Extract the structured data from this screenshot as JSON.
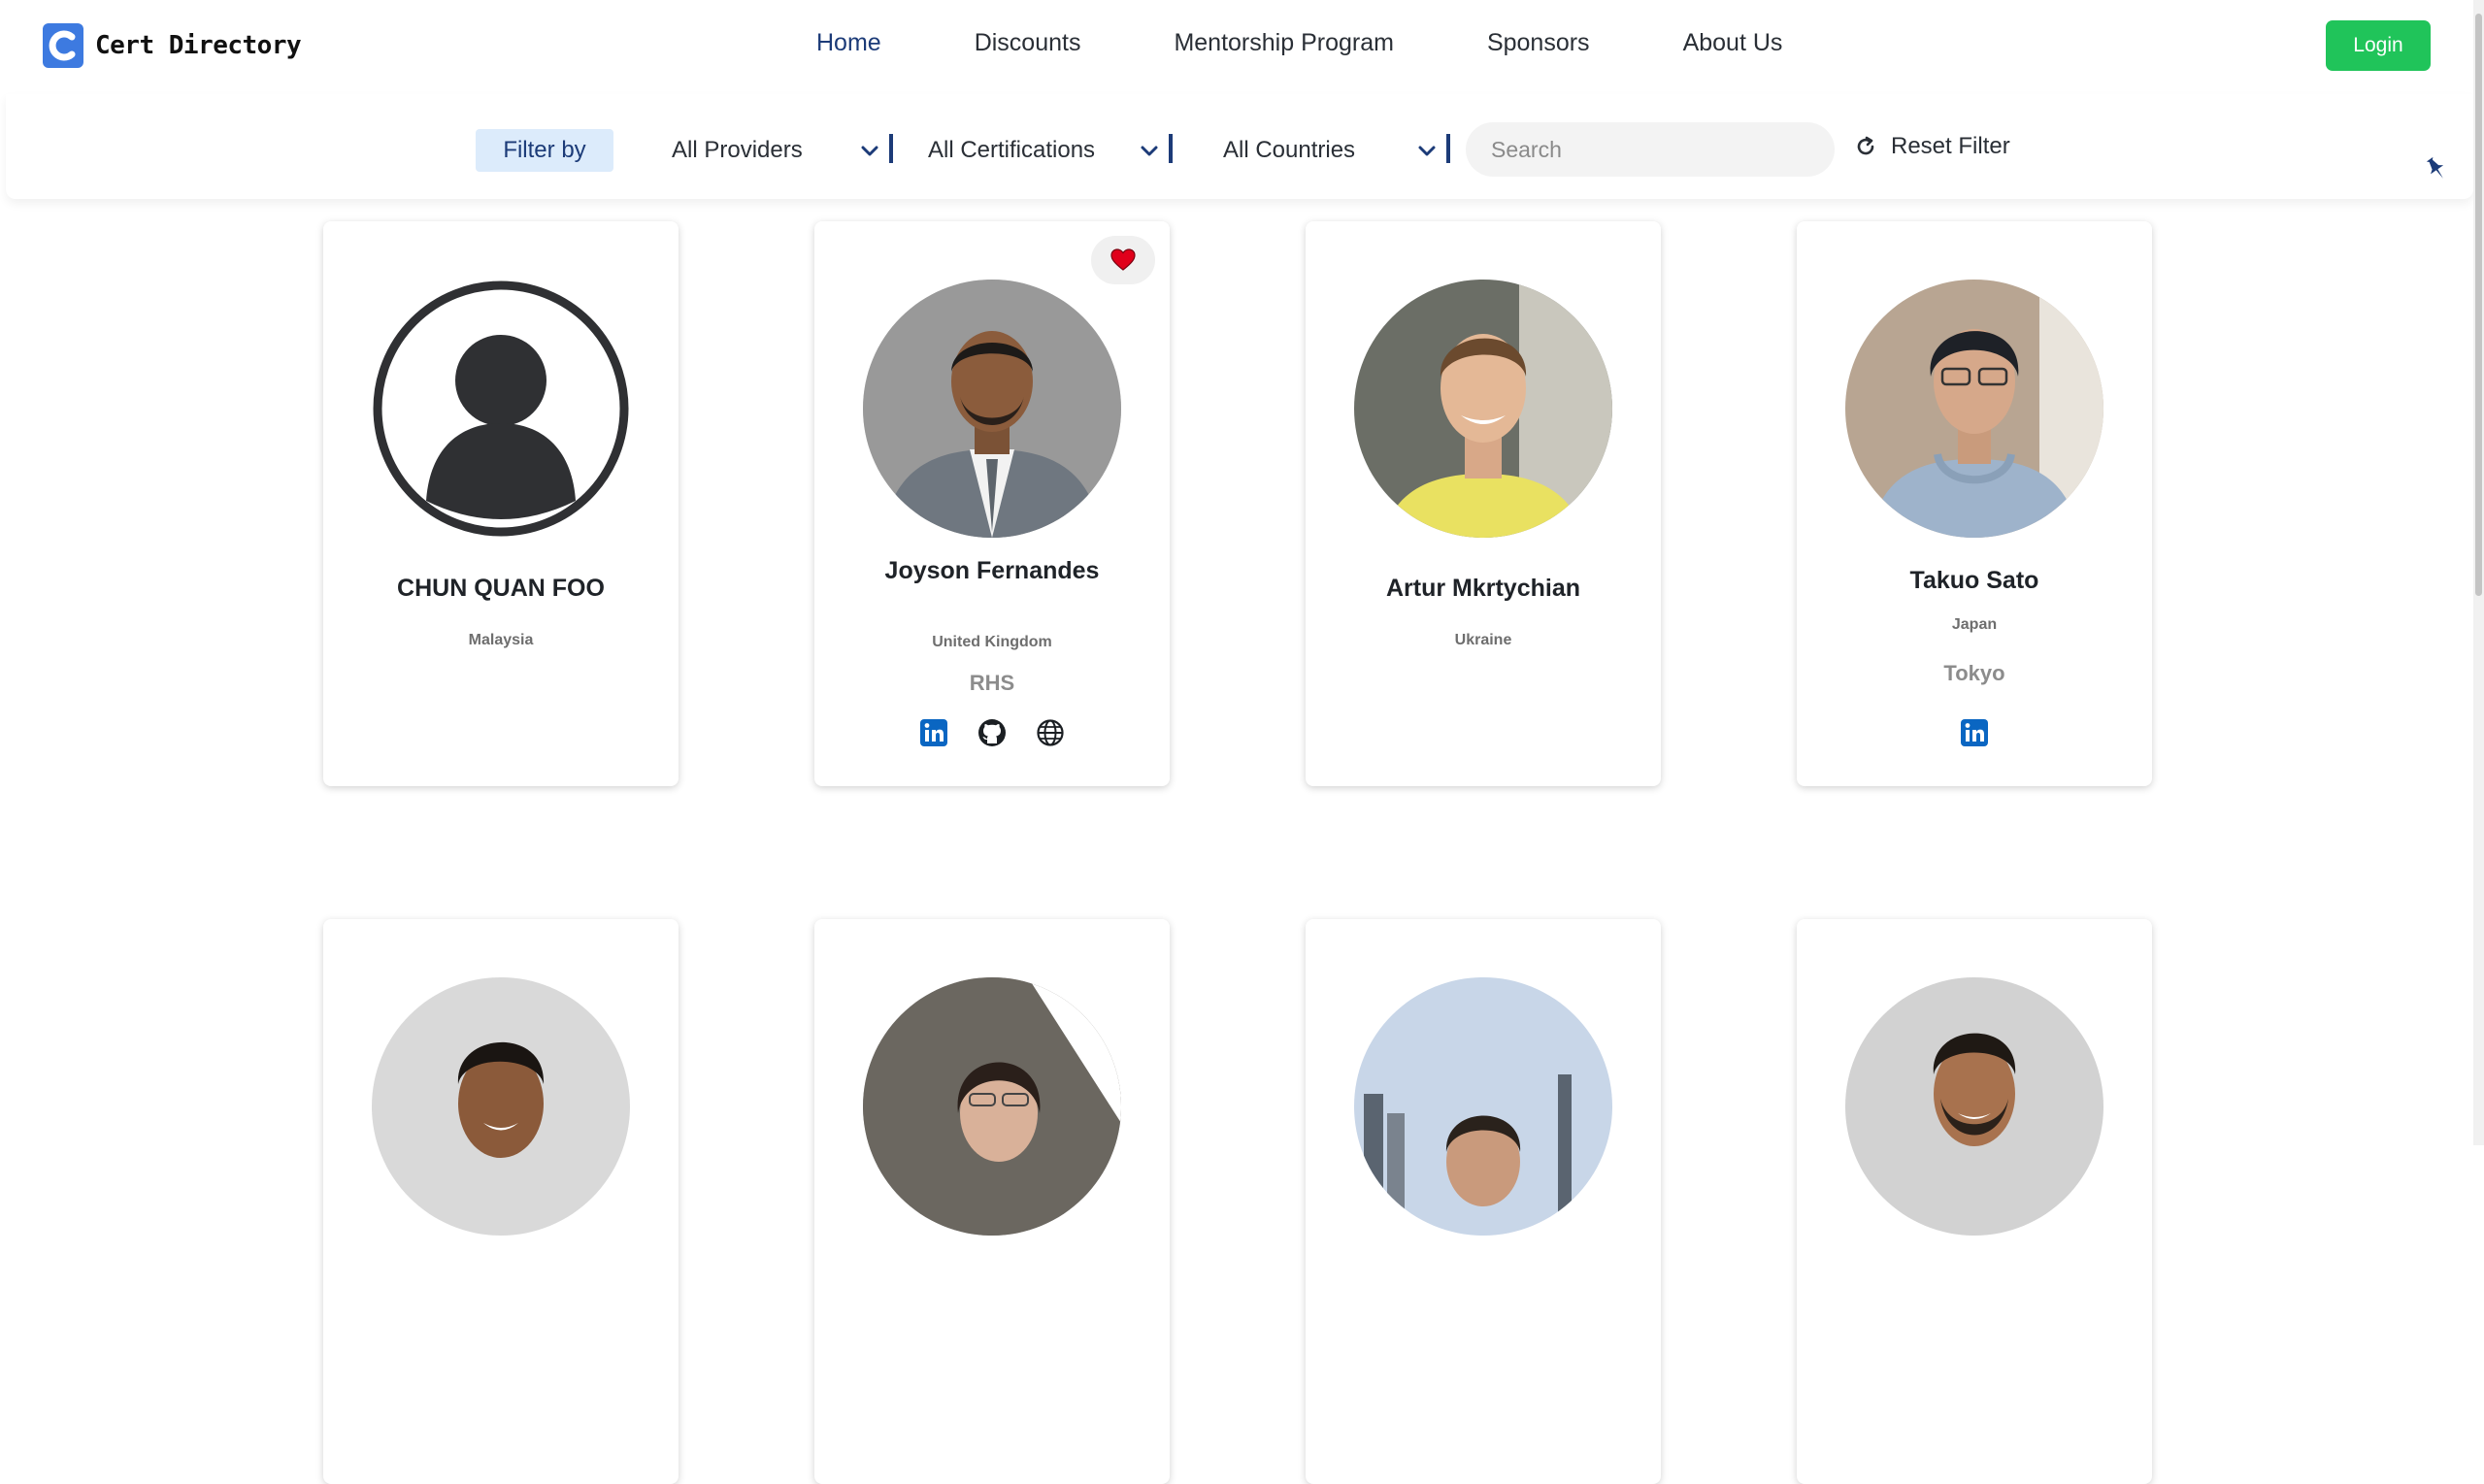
{
  "brand": {
    "name": "Cert Directory",
    "accent": "#3d7ae0"
  },
  "nav": {
    "items": [
      {
        "label": "Home",
        "active": true
      },
      {
        "label": "Discounts"
      },
      {
        "label": "Mentorship Program"
      },
      {
        "label": "Sponsors"
      },
      {
        "label": "About Us"
      }
    ],
    "login_label": "Login",
    "login_color": "#20c45a"
  },
  "filters": {
    "filter_by_label": "Filter by",
    "providers_label": "All Providers",
    "certifications_label": "All Certifications",
    "countries_label": "All Countries",
    "search_placeholder": "Search",
    "reset_label": "Reset Filter"
  },
  "cards": [
    {
      "name": "CHUN QUAN FOO",
      "country": "Malaysia",
      "extra": "",
      "socials": [],
      "avatar": "placeholder-avatar-icon"
    },
    {
      "name": "Joyson Fernandes",
      "country": "United Kingdom",
      "extra": "RHS",
      "socials": [
        "linkedin",
        "github",
        "globe"
      ],
      "favorite": true
    },
    {
      "name": "Artur Mkrtychian",
      "country": "Ukraine",
      "extra": "",
      "socials": []
    },
    {
      "name": "Takuo Sato",
      "country": "Japan",
      "extra": "Tokyo",
      "socials": [
        "linkedin"
      ]
    },
    {
      "name": "",
      "country": "",
      "extra": "",
      "socials": []
    },
    {
      "name": "",
      "country": "",
      "extra": "",
      "socials": []
    },
    {
      "name": "",
      "country": "",
      "extra": "",
      "socials": []
    },
    {
      "name": "",
      "country": "",
      "extra": "",
      "socials": []
    }
  ]
}
